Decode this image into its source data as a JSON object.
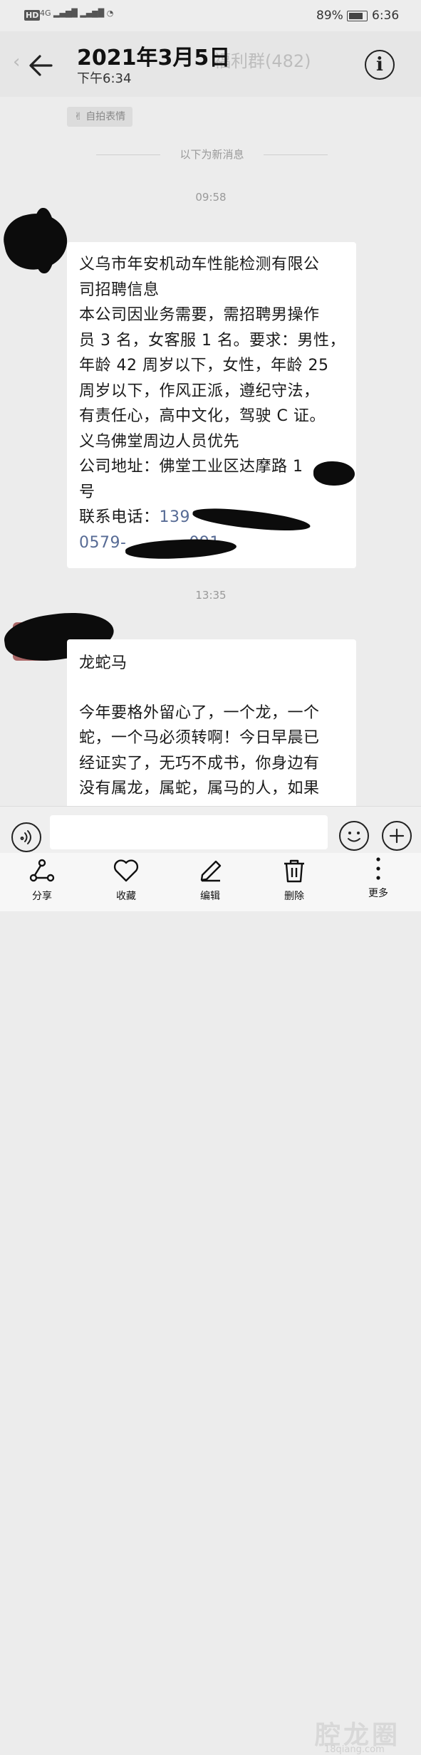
{
  "status_bar": {
    "network": "4G",
    "battery": "89%",
    "time": "6:36"
  },
  "header": {
    "title": "2021年3月5日",
    "subtitle": "下午6:34",
    "chat_name": "福利群(482)"
  },
  "selfie_sticker_label": "自拍表情",
  "new_messages_divider": "以下为新消息",
  "messages": [
    {
      "time": "09:58",
      "lines": [
        "义乌市年安机动车性能检测有限公",
        "司招聘信息",
        "本公司因业务需要，需招聘男操作",
        "员 3 名，女客服 1 名。要求：男性，",
        "年龄 42 周岁以下，女性，年龄 25",
        "周岁以下，作风正派，遵纪守法，",
        "有责任心，高中文化，驾驶 C 证。",
        "义乌佛堂周边人员优先",
        "公司地址：佛堂工业区达摩路 1",
        "号"
      ],
      "phone_label": "联系电话：",
      "phone1": "139",
      "phone2": "0579-",
      "phone2_tail": "091"
    },
    {
      "time": "13:35",
      "title": "龙蛇马",
      "lines": [
        "今年要格外留心了，一个龙，一个",
        "蛇，一个马必须转啊！今日早晨已",
        "经证实了，无巧不成书，你身边有",
        "没有属龙，属蛇，属马的人，如果"
      ]
    }
  ],
  "toolbar": {
    "share": "分享",
    "favorite": "收藏",
    "edit": "编辑",
    "delete": "删除",
    "more": "更多"
  },
  "watermark": "腔龙圈",
  "watermark_url": "18qiang.com"
}
